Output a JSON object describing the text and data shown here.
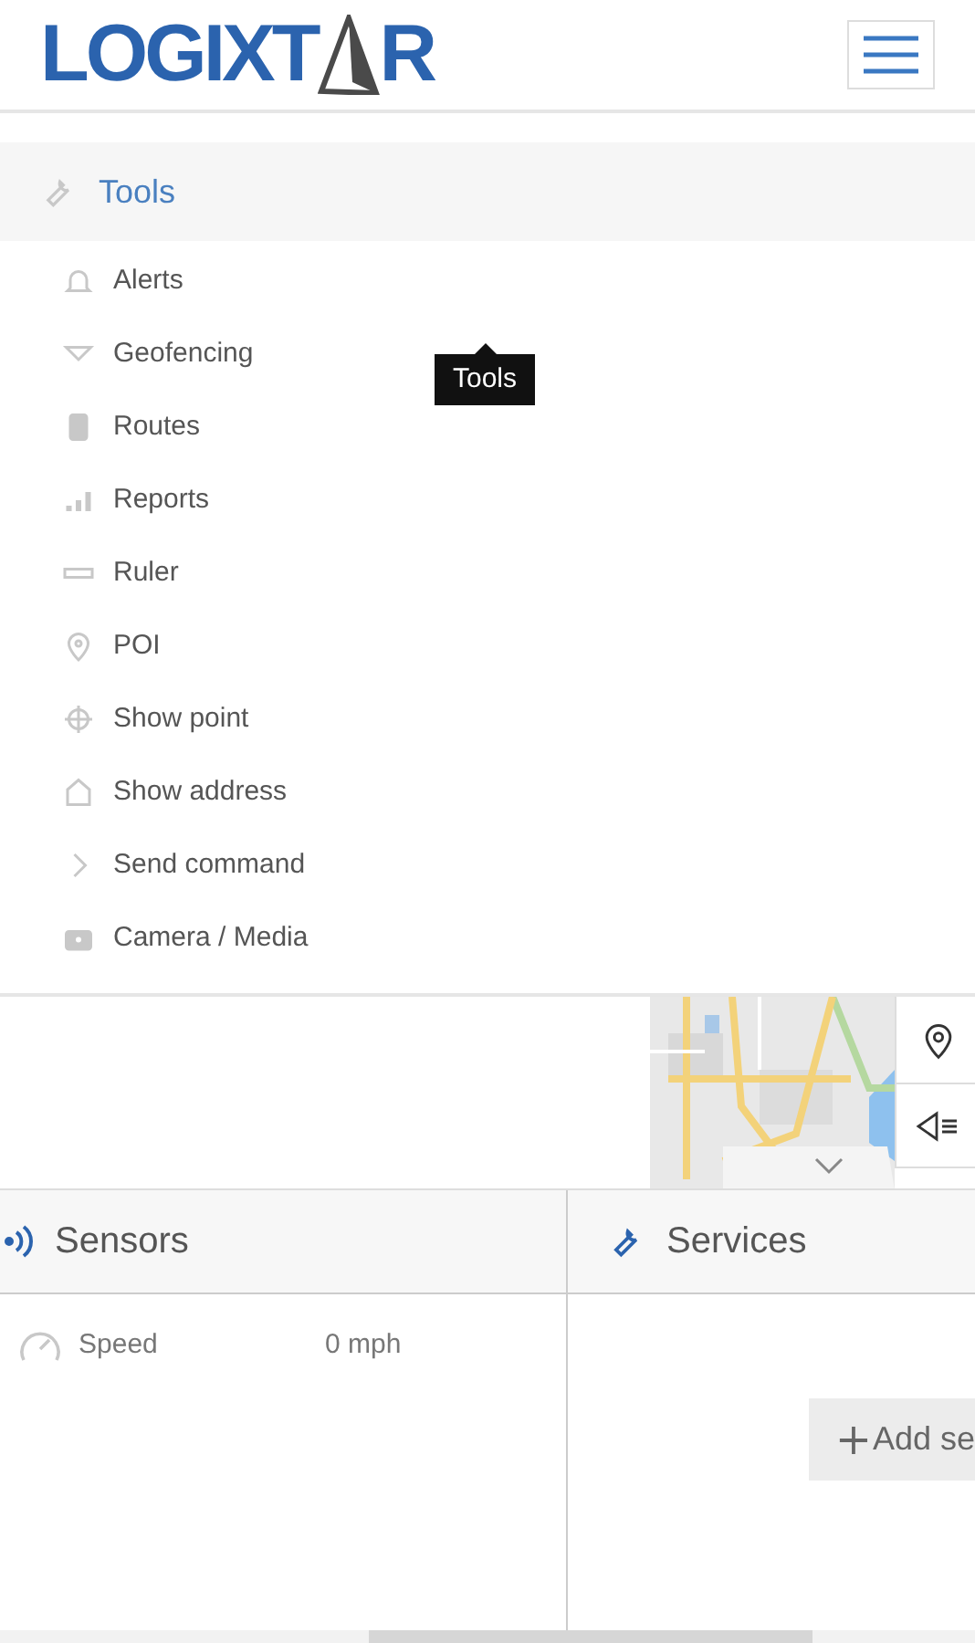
{
  "header": {
    "logo": {
      "before_mark": "LOGIXT",
      "after_mark": "R"
    }
  },
  "tools_menu": {
    "title": "Tools",
    "tooltip": "Tools",
    "items": [
      {
        "kind": "bell",
        "label": "Alerts"
      },
      {
        "kind": "fence",
        "label": "Geofencing"
      },
      {
        "kind": "route",
        "label": "Routes"
      },
      {
        "kind": "chart",
        "label": "Reports"
      },
      {
        "kind": "ruler",
        "label": "Ruler"
      },
      {
        "kind": "pin",
        "label": "POI"
      },
      {
        "kind": "crosshair",
        "label": "Show point"
      },
      {
        "kind": "house",
        "label": "Show address"
      },
      {
        "kind": "chevron",
        "label": "Send command"
      },
      {
        "kind": "camera",
        "label": "Camera / Media"
      }
    ]
  },
  "sensors": {
    "title": "Sensors",
    "rows": [
      {
        "name": "Speed",
        "value": "0 mph"
      }
    ]
  },
  "services": {
    "title": "Services",
    "add_button": "Add se"
  }
}
